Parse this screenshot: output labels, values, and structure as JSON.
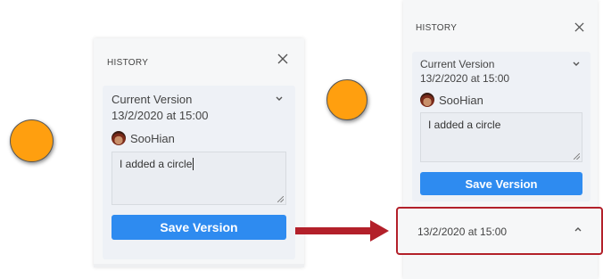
{
  "left_panel": {
    "title": "HISTORY",
    "version_title": "Current Version",
    "version_time": "13/2/2020 at 15:00",
    "user": "SooHian",
    "comment": "I added a circle",
    "save_label": "Save Version"
  },
  "right_panel": {
    "title": "HISTORY",
    "version_title": "Current Version",
    "version_time": "13/2/2020 at 15:00",
    "user": "SooHian",
    "comment": "I added a circle",
    "save_label": "Save Version",
    "history_item_time": "13/2/2020 at 15:00"
  },
  "colors": {
    "circle_fill": "#FF9F0F",
    "button_blue": "#2e8bf0",
    "arrow_red": "#b3202a"
  },
  "icons": [
    "close-icon",
    "chevron-down-icon",
    "chevron-up-icon",
    "arrow-right-icon",
    "avatar"
  ]
}
